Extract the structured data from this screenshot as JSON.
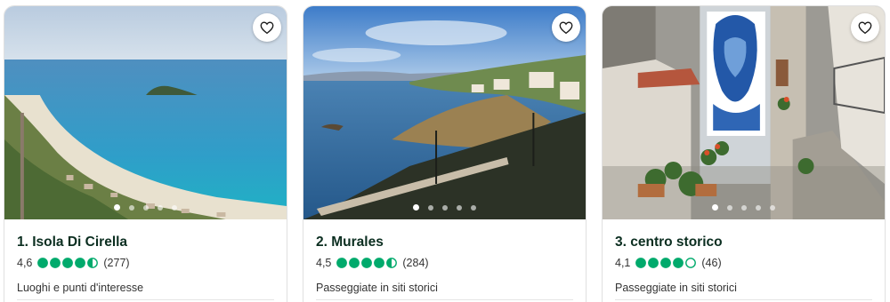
{
  "cards": [
    {
      "title": "1. Isola Di Cirella",
      "rating": "4,6",
      "rating_value": 4.5,
      "reviews": "(277)",
      "category": "Luoghi e punti d'interesse",
      "photo_dots": 5,
      "active_dot": 0
    },
    {
      "title": "2. Murales",
      "rating": "4,5",
      "rating_value": 4.5,
      "reviews": "(284)",
      "category": "Passeggiate in siti storici",
      "photo_dots": 5,
      "active_dot": 0
    },
    {
      "title": "3. centro storico",
      "rating": "4,1",
      "rating_value": 4,
      "reviews": "(46)",
      "category": "Passeggiate in siti storici",
      "photo_dots": 5,
      "active_dot": 0
    }
  ],
  "colors": {
    "bubble": "#00aa6c",
    "title": "#0b2e20"
  },
  "icons": {
    "save": "heart-outline-icon",
    "rating": "rating-bubble-icon"
  }
}
